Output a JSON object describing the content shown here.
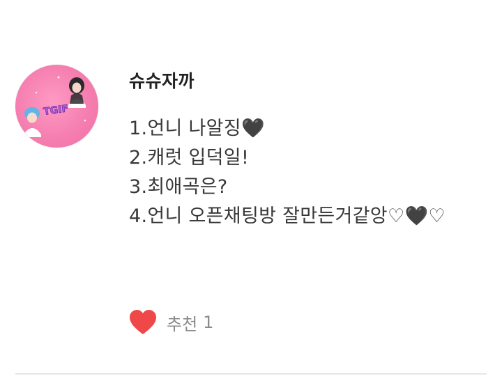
{
  "comment": {
    "username": "슈슈자까",
    "avatar_image": "avatar-image",
    "avatar_text": "TGIF",
    "lines": [
      "1.언니 나알징🖤",
      "2.캐럿 입덕일!",
      "3.최애곡은?",
      "4.언니 오픈채팅방 잘만든거같앙♡🖤♡"
    ],
    "like": {
      "icon": "heart-icon",
      "label": "추천",
      "count": "1",
      "color": "#f04848"
    }
  },
  "colors": {
    "avatar_bg": "#f57fb0",
    "text": "#383838",
    "muted": "#8a8a8a",
    "divider": "#e6e6e6"
  }
}
